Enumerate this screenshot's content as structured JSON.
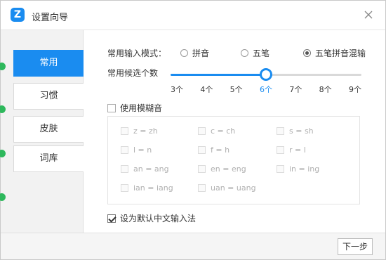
{
  "window": {
    "title": "设置向导",
    "logo_glyph": "Z",
    "accent_color": "#1a8cf0"
  },
  "sidebar": {
    "items": [
      {
        "label": "常用",
        "active": true
      },
      {
        "label": "习惯",
        "active": false
      },
      {
        "label": "皮肤",
        "active": false
      },
      {
        "label": "词库",
        "active": false
      }
    ]
  },
  "input_mode": {
    "label": "常用输入模式：",
    "options": [
      "拼音",
      "五笔",
      "五笔拼音混输"
    ],
    "selected": "五笔拼音混输"
  },
  "candidates": {
    "label": "常用候选个数",
    "ticks": [
      "3个",
      "4个",
      "5个",
      "6个",
      "7个",
      "8个",
      "9个"
    ],
    "selected_index": 3
  },
  "fuzzy": {
    "label": "使用模糊音",
    "enabled": false,
    "items": [
      "z = zh",
      "c = ch",
      "s = sh",
      "l = n",
      "f = h",
      "r = l",
      "an = ang",
      "en = eng",
      "in = ing",
      "ian = iang",
      "uan = uang"
    ]
  },
  "default_ime": {
    "label": "设为默认中文输入法",
    "checked": true
  },
  "footer": {
    "next_label": "下一步"
  }
}
